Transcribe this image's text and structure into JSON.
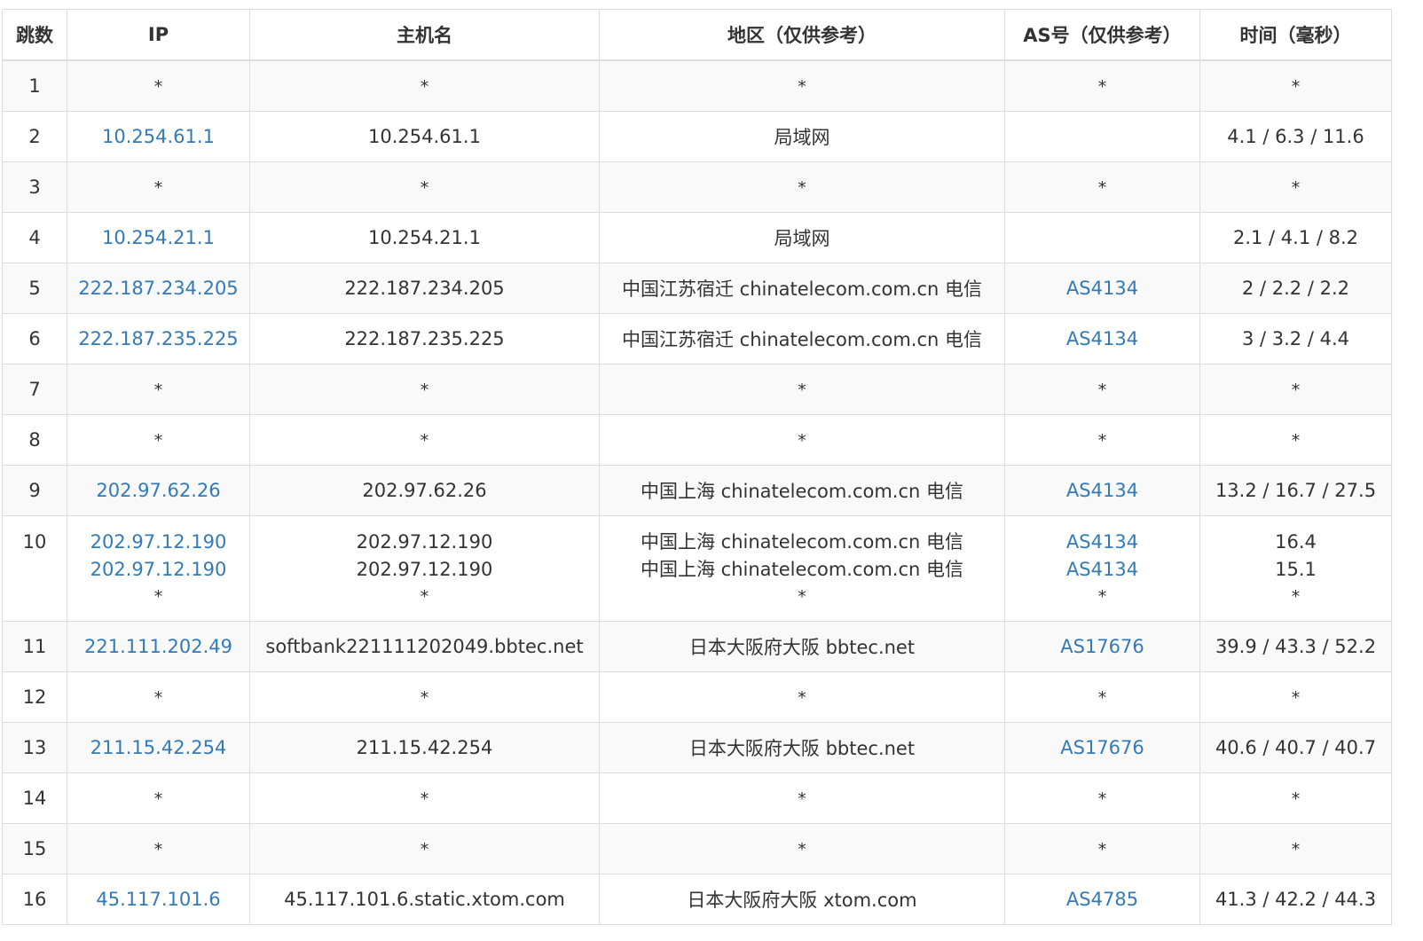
{
  "headers": {
    "hop": "跳数",
    "ip": "IP",
    "host": "主机名",
    "region": "地区（仅供参考）",
    "as": "AS号（仅供参考）",
    "time": "时间（毫秒）"
  },
  "rows": [
    {
      "hop": "1",
      "ip": [
        "*"
      ],
      "host": [
        "*"
      ],
      "region": [
        "*"
      ],
      "as": [
        "*"
      ],
      "time": [
        "*"
      ]
    },
    {
      "hop": "2",
      "ip": [
        "10.254.61.1"
      ],
      "host": [
        "10.254.61.1"
      ],
      "region": [
        "局域网"
      ],
      "as": [
        ""
      ],
      "time": [
        "4.1 / 6.3 / 11.6"
      ]
    },
    {
      "hop": "3",
      "ip": [
        "*"
      ],
      "host": [
        "*"
      ],
      "region": [
        "*"
      ],
      "as": [
        "*"
      ],
      "time": [
        "*"
      ]
    },
    {
      "hop": "4",
      "ip": [
        "10.254.21.1"
      ],
      "host": [
        "10.254.21.1"
      ],
      "region": [
        "局域网"
      ],
      "as": [
        ""
      ],
      "time": [
        "2.1 / 4.1 / 8.2"
      ]
    },
    {
      "hop": "5",
      "ip": [
        "222.187.234.205"
      ],
      "host": [
        "222.187.234.205"
      ],
      "region": [
        "中国江苏宿迁 chinatelecom.com.cn 电信"
      ],
      "as": [
        "AS4134"
      ],
      "time": [
        "2 / 2.2 / 2.2"
      ]
    },
    {
      "hop": "6",
      "ip": [
        "222.187.235.225"
      ],
      "host": [
        "222.187.235.225"
      ],
      "region": [
        "中国江苏宿迁 chinatelecom.com.cn 电信"
      ],
      "as": [
        "AS4134"
      ],
      "time": [
        "3 / 3.2 / 4.4"
      ]
    },
    {
      "hop": "7",
      "ip": [
        "*"
      ],
      "host": [
        "*"
      ],
      "region": [
        "*"
      ],
      "as": [
        "*"
      ],
      "time": [
        "*"
      ]
    },
    {
      "hop": "8",
      "ip": [
        "*"
      ],
      "host": [
        "*"
      ],
      "region": [
        "*"
      ],
      "as": [
        "*"
      ],
      "time": [
        "*"
      ]
    },
    {
      "hop": "9",
      "ip": [
        "202.97.62.26"
      ],
      "host": [
        "202.97.62.26"
      ],
      "region": [
        "中国上海 chinatelecom.com.cn 电信"
      ],
      "as": [
        "AS4134"
      ],
      "time": [
        "13.2 / 16.7 / 27.5"
      ]
    },
    {
      "hop": "10",
      "ip": [
        "202.97.12.190",
        "202.97.12.190",
        "*"
      ],
      "host": [
        "202.97.12.190",
        "202.97.12.190",
        "*"
      ],
      "region": [
        "中国上海 chinatelecom.com.cn 电信",
        "中国上海 chinatelecom.com.cn 电信",
        "*"
      ],
      "as": [
        "AS4134",
        "AS4134",
        "*"
      ],
      "time": [
        "16.4",
        "15.1",
        "*"
      ]
    },
    {
      "hop": "11",
      "ip": [
        "221.111.202.49"
      ],
      "host": [
        "softbank221111202049.bbtec.net"
      ],
      "region": [
        "日本大阪府大阪 bbtec.net"
      ],
      "as": [
        "AS17676"
      ],
      "time": [
        "39.9 / 43.3 / 52.2"
      ]
    },
    {
      "hop": "12",
      "ip": [
        "*"
      ],
      "host": [
        "*"
      ],
      "region": [
        "*"
      ],
      "as": [
        "*"
      ],
      "time": [
        "*"
      ]
    },
    {
      "hop": "13",
      "ip": [
        "211.15.42.254"
      ],
      "host": [
        "211.15.42.254"
      ],
      "region": [
        "日本大阪府大阪 bbtec.net"
      ],
      "as": [
        "AS17676"
      ],
      "time": [
        "40.6 / 40.7 / 40.7"
      ]
    },
    {
      "hop": "14",
      "ip": [
        "*"
      ],
      "host": [
        "*"
      ],
      "region": [
        "*"
      ],
      "as": [
        "*"
      ],
      "time": [
        "*"
      ]
    },
    {
      "hop": "15",
      "ip": [
        "*"
      ],
      "host": [
        "*"
      ],
      "region": [
        "*"
      ],
      "as": [
        "*"
      ],
      "time": [
        "*"
      ]
    },
    {
      "hop": "16",
      "ip": [
        "45.117.101.6"
      ],
      "host": [
        "45.117.101.6.static.xtom.com"
      ],
      "region": [
        "日本大阪府大阪 xtom.com"
      ],
      "as": [
        "AS4785"
      ],
      "time": [
        "41.3 / 42.2 / 44.3"
      ]
    }
  ],
  "colors": {
    "link": "#337ab7",
    "text": "#333333",
    "border": "#dddddd",
    "stripe": "#f9f9f9"
  }
}
